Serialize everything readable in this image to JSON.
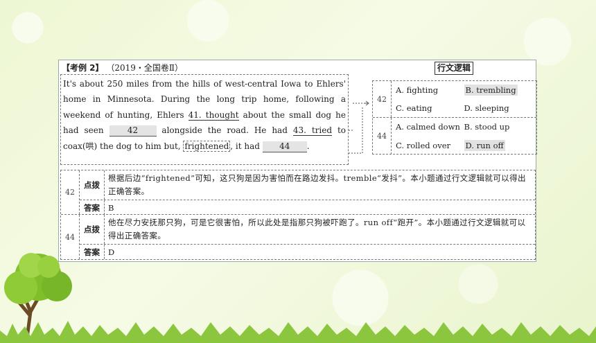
{
  "header": {
    "label": "【考例 2】",
    "source": "（2019・全国卷Ⅱ）",
    "logic_tag": "行文逻辑"
  },
  "passage": {
    "p1": "It's about 250 miles from the hills of west-central Iowa to Ehlers' home in Minnesota. During the long trip home, following a weekend of hunting, Ehlers",
    "ans41": "41. thought",
    "p2": "about the small dog he had seen",
    "blank42": "42",
    "p3": "alongside the road. He had",
    "ans43": "43. tried",
    "p4": "to coax(哄) the dog to him but,",
    "frightened": "frightened",
    "p5": ", it had",
    "blank44": "44",
    "p6": "."
  },
  "options": [
    {
      "num": "42",
      "items": [
        "A. fighting",
        "B. trembling",
        "C. eating",
        "D. sleeping"
      ],
      "highlight": 1
    },
    {
      "num": "44",
      "items": [
        "A. calmed down",
        "B. stood up",
        "C. rolled over",
        "D. run off"
      ],
      "highlight": 3
    }
  ],
  "table": [
    {
      "num": "42",
      "hint_label": "点拨",
      "hint": "根据后边“frightened”可知，这只狗是因为害怕而在路边发抖。tremble“发抖”。本小题通过行文逻辑就可以得出正确答案。",
      "ans_label": "答案",
      "answer": "B"
    },
    {
      "num": "44",
      "hint_label": "点拨",
      "hint": "他在尽力安抚那只狗，可是它很害怕，所以此处是指那只狗被吓跑了。run off“跑开”。本小题通过行文逻辑就可以得出正确答案。",
      "ans_label": "答案",
      "answer": "D"
    }
  ]
}
